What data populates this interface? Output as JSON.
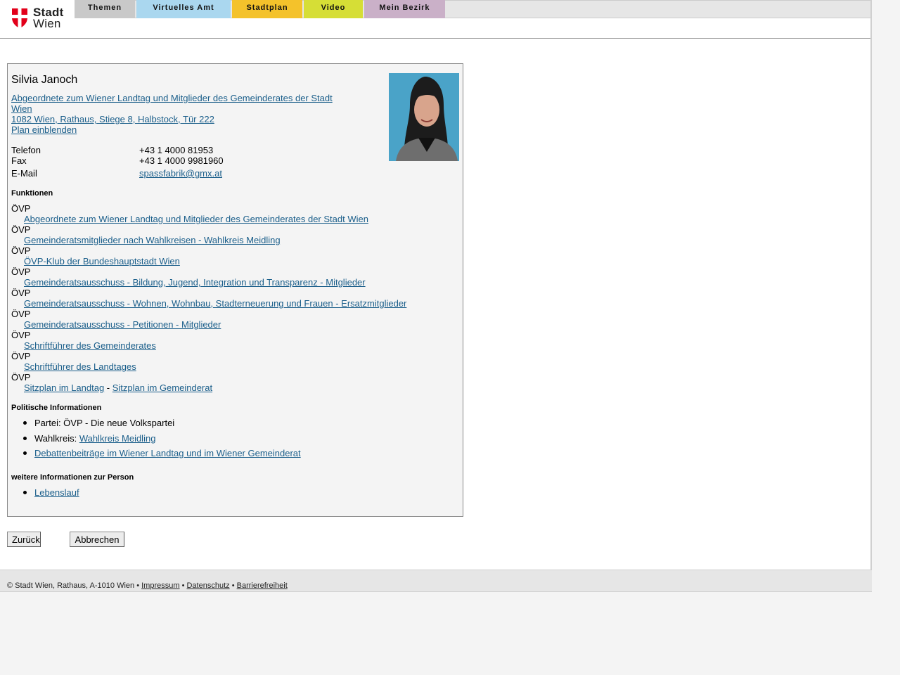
{
  "logo": {
    "line1": "Stadt",
    "line2": "Wien"
  },
  "nav": {
    "tabs": [
      {
        "label": "Themen",
        "color": "#c9c9c9"
      },
      {
        "label": "Virtuelles Amt",
        "color": "#aad7ef"
      },
      {
        "label": "Stadtplan",
        "color": "#f4c22b"
      },
      {
        "label": "Video",
        "color": "#d6de36"
      },
      {
        "label": "Mein Bezirk",
        "color": "#cab0c8"
      }
    ]
  },
  "person": {
    "name": "Silvia Janoch",
    "role_link": "Abgeordnete zum Wiener Landtag und Mitglieder des Gemeinderates der Stadt Wien",
    "address_link": "1082 Wien, Rathaus, Stiege 8, Halbstock, Tür 222",
    "plan_link": "Plan einblenden"
  },
  "contact": {
    "phone_label": "Telefon",
    "phone": "+43 1 4000 81953",
    "fax_label": "Fax",
    "fax": "+43 1 4000 9981960",
    "email_label": "E-Mail",
    "email": "spassfabrik@gmx.at"
  },
  "functions": {
    "heading": "Funktionen",
    "items": [
      {
        "party": "ÖVP",
        "link": "Abgeordnete zum Wiener Landtag und Mitglieder des Gemeinderates der Stadt Wien"
      },
      {
        "party": "ÖVP",
        "link": "Gemeinderatsmitglieder nach Wahlkreisen - Wahlkreis Meidling"
      },
      {
        "party": "ÖVP",
        "link": "ÖVP-Klub der Bundeshauptstadt Wien"
      },
      {
        "party": "ÖVP",
        "link": "Gemeinderatsausschuss - Bildung, Jugend, Integration und Transparenz - Mitglieder"
      },
      {
        "party": "ÖVP",
        "link": "Gemeinderatsausschuss - Wohnen, Wohnbau, Stadterneuerung und Frauen - Ersatzmitglieder"
      },
      {
        "party": "ÖVP",
        "link": "Gemeinderatsausschuss - Petitionen - Mitglieder"
      },
      {
        "party": "ÖVP",
        "link": "Schriftführer des Gemeinderates"
      },
      {
        "party": "ÖVP",
        "link": "Schriftführer des Landtages"
      }
    ],
    "last": {
      "party": "ÖVP",
      "link1": "Sitzplan im Landtag",
      "sep": " - ",
      "link2": "Sitzplan im Gemeinderat"
    }
  },
  "political": {
    "heading": "Politische Informationen",
    "party_text": "Partei: ÖVP - Die neue Volkspartei",
    "district_label": "Wahlkreis: ",
    "district_link": "Wahlkreis Meidling",
    "debates_link": "Debattenbeiträge im Wiener Landtag und im Wiener Gemeinderat"
  },
  "more": {
    "heading": "weitere Informationen zur Person",
    "cv_link": "Lebenslauf"
  },
  "buttons": {
    "back": "Zurück",
    "cancel": "Abbrechen"
  },
  "footer": {
    "copyright": "© Stadt Wien, Rathaus, A-1010 Wien",
    "bullet": " • ",
    "impressum": "Impressum",
    "datenschutz": "Datenschutz",
    "barrierefreiheit": "Barrierefreiheit"
  }
}
